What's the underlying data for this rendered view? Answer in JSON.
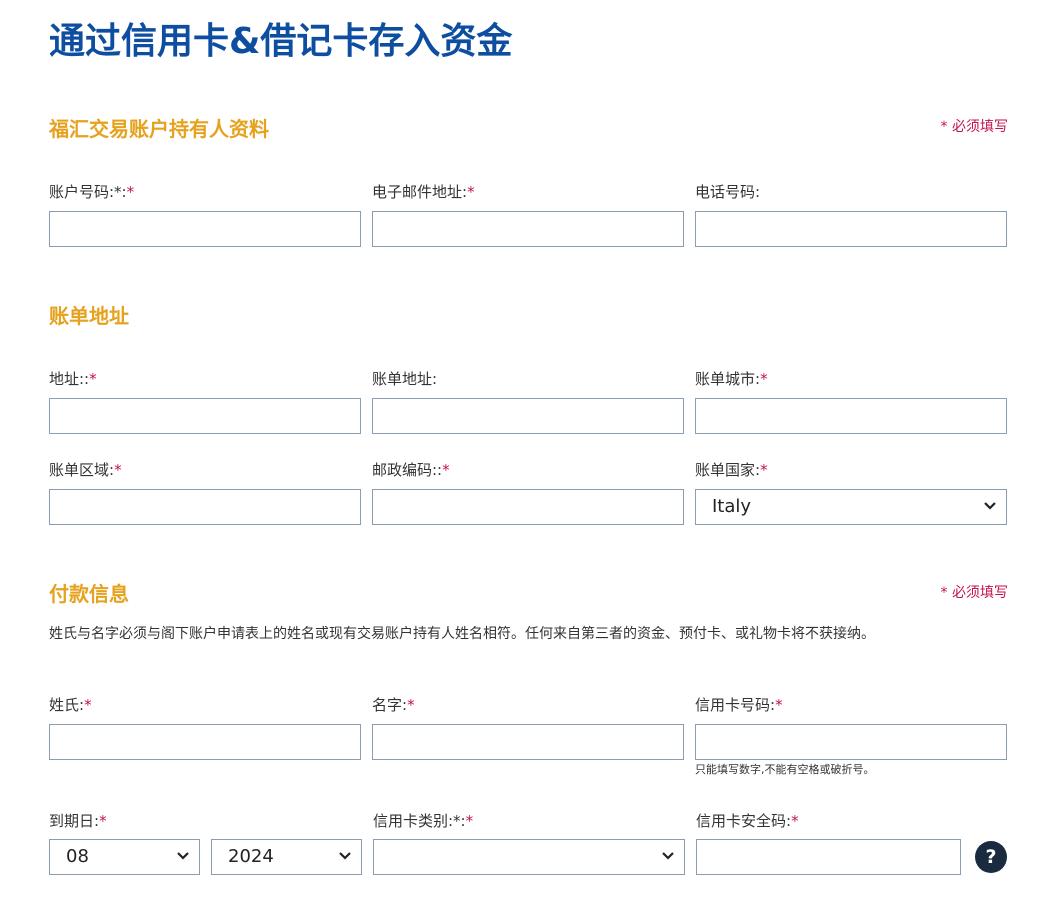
{
  "page": {
    "title": "通过信用卡&借记卡存入资金",
    "required_text": "* 必须填写"
  },
  "account_section": {
    "title": "福汇交易账户持有人资料",
    "fields": {
      "account_number": {
        "label": "账户号码:*:",
        "required": true,
        "value": ""
      },
      "email": {
        "label": "电子邮件地址:",
        "required": true,
        "value": ""
      },
      "phone": {
        "label": "电话号码:",
        "required": false,
        "value": ""
      }
    }
  },
  "billing_section": {
    "title": "账单地址",
    "fields": {
      "address": {
        "label": "地址::",
        "required": true,
        "value": ""
      },
      "billing_address": {
        "label": "账单地址:",
        "required": false,
        "value": ""
      },
      "billing_city": {
        "label": "账单城市:",
        "required": true,
        "value": ""
      },
      "billing_region": {
        "label": "账单区域:",
        "required": true,
        "value": ""
      },
      "postal_code": {
        "label": "邮政编码::",
        "required": true,
        "value": ""
      },
      "billing_country": {
        "label": "账单国家:",
        "required": true,
        "selected": "Italy"
      }
    }
  },
  "payment_section": {
    "title": "付款信息",
    "note": "姓氏与名字必须与阁下账户申请表上的姓名或现有交易账户持有人姓名相符。任何来自第三者的资金、预付卡、或礼物卡将不获接纳。",
    "fields": {
      "last_name": {
        "label": "姓氏:",
        "required": true,
        "value": ""
      },
      "first_name": {
        "label": "名字:",
        "required": true,
        "value": ""
      },
      "card_number": {
        "label": "信用卡号码:",
        "required": true,
        "value": "",
        "hint": "只能填写数字,不能有空格或破折号。"
      },
      "expiry": {
        "label": "到期日:",
        "required": true,
        "month": "08",
        "year": "2024"
      },
      "card_type": {
        "label": "信用卡类别:*:",
        "required": true,
        "selected": ""
      },
      "cvv": {
        "label": "信用卡安全码:",
        "required": true,
        "value": ""
      }
    },
    "help_icon_glyph": "?"
  },
  "colors": {
    "title_blue": "#0d4ea1",
    "section_gold": "#e6a21f",
    "required_red": "#c4124d",
    "input_border": "#8b9db3",
    "help_icon_bg": "#1a2b40"
  },
  "icons": {
    "select_arrow": "chevron-down-icon",
    "help": "question-mark-icon"
  }
}
